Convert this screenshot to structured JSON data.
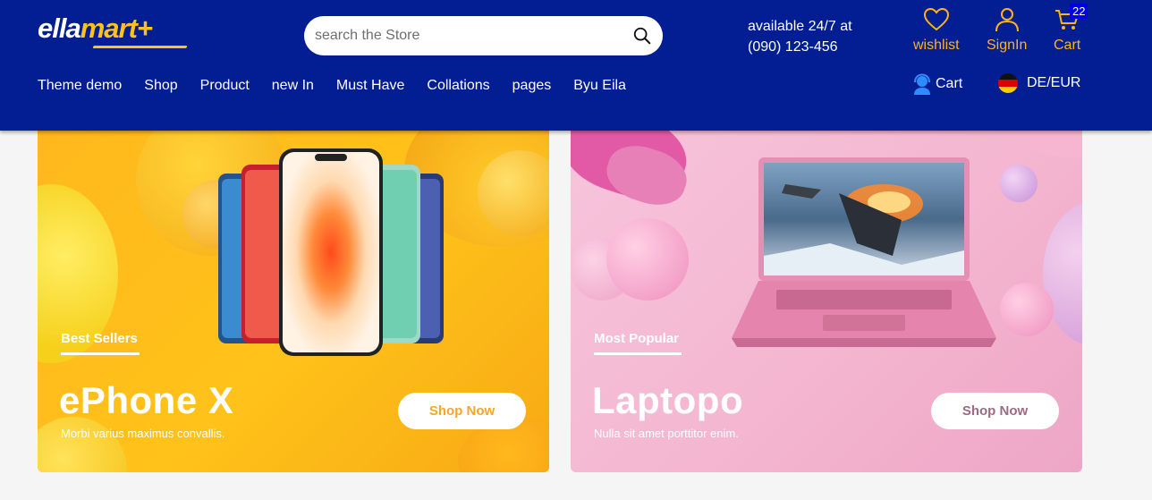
{
  "header": {
    "logo": {
      "part1": "ella",
      "part2": "mart+"
    },
    "search": {
      "placeholder": "search the Store",
      "value": ""
    },
    "availability": {
      "line1": "available 24/7 at",
      "line2": "(090) 123-456"
    },
    "icons": {
      "wishlist_label": "wishlist",
      "signin_label": "SignIn",
      "cart_label": "Cart",
      "cart_count": "22"
    },
    "nav": [
      {
        "label": "Theme demo"
      },
      {
        "label": "Shop"
      },
      {
        "label": "Product"
      },
      {
        "label": "new In"
      },
      {
        "label": "Must Have"
      },
      {
        "label": "Collations"
      },
      {
        "label": "pages"
      },
      {
        "label": "Byu Eila"
      }
    ],
    "nav_cart_label": "Cart",
    "language_label": "DE/EUR"
  },
  "banners": [
    {
      "kicker": "Best Sellers",
      "title": "ePhone X",
      "subtitle": "Morbi varius maximus convallis.",
      "button": "Shop Now",
      "image": "iphone-lineup-image"
    },
    {
      "kicker": "Most Popular",
      "title": "Laptopo",
      "subtitle": "Nulla sit amet porttitor enim.",
      "button": "Shop Now",
      "image": "pink-laptop-image"
    }
  ],
  "colors": {
    "header_bg": "#021e92",
    "accent": "#ffc21a",
    "icon_color": "#ffb31a",
    "banner_yellow": "#ffc21a",
    "banner_pink": "#f4b6d0"
  }
}
